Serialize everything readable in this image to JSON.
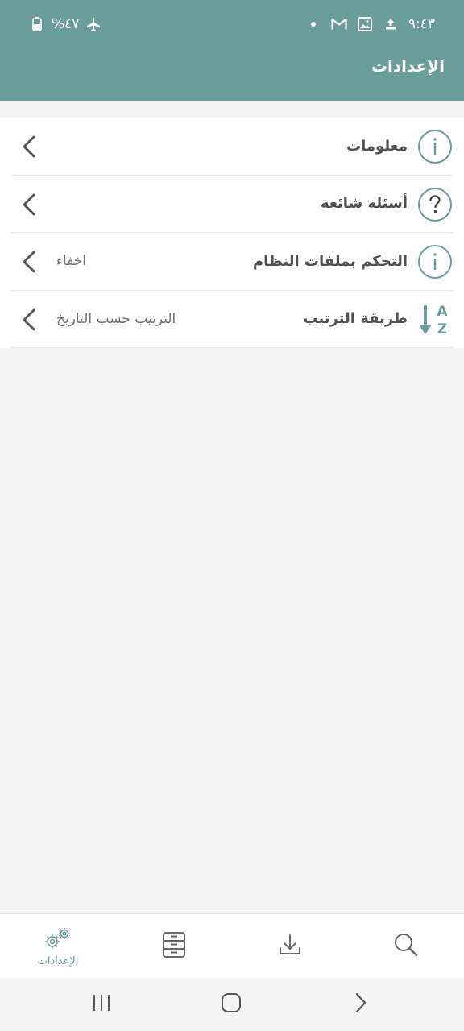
{
  "status_bar": {
    "time": "٩:٤٣",
    "battery": "%٤٧"
  },
  "header": {
    "title": "الإعدادات"
  },
  "settings": {
    "items": [
      {
        "label": "معلومات",
        "value": "",
        "icon": "info-icon"
      },
      {
        "label": "أسئلة شائعة",
        "value": "",
        "icon": "help-icon"
      },
      {
        "label": "التحكم بملفات النظام",
        "value": "اخفاء",
        "icon": "info-icon"
      },
      {
        "label": "طريقة الترتيب",
        "value": "الترتيب حسب التاريخ",
        "icon": "sort-az-icon"
      }
    ]
  },
  "bottom_nav": {
    "settings_label": "الإعدادات",
    "icons": [
      "settings-gears-icon",
      "file-cabinet-icon",
      "download-icon",
      "search-icon"
    ]
  },
  "colors": {
    "accent": "#6a9d9a",
    "background": "#f5f5f5",
    "text": "#505050"
  }
}
